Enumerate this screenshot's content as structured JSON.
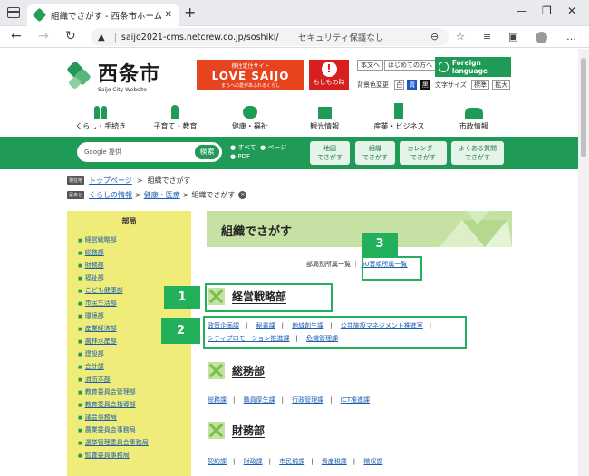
{
  "browser": {
    "tab_title": "組織でさがす - 西条市ホームページ",
    "tab_close": "✕",
    "new_tab": "+",
    "security_label": "セキュリティ保護なし",
    "url": "saijo2021-cms.netcrew.co.jp/soshiki/",
    "window_controls": [
      "—",
      "❐",
      "✕"
    ],
    "toolbar_menu": "…"
  },
  "header": {
    "logo_jp": "西条市",
    "logo_en": "Saijo City Website",
    "banner1_small": "移住定住サイト",
    "banner1_big": "LOVE SAIJO",
    "banner1_tag": "まちへの愛があふれるくらし",
    "banner2_mark": "!",
    "banner2_label": "もしもの時",
    "btn_text_version": "本文へ",
    "btn_first_visit": "はじめての方へ",
    "foreign_language": "Foreign language",
    "bg_color_label": "背景色変更",
    "bg_options": [
      "白",
      "青",
      "黒"
    ],
    "text_size_label": "文字サイズ",
    "text_size_options": [
      "標準",
      "拡大"
    ]
  },
  "global_nav": [
    {
      "label": "くらし・手続き",
      "icon": "family-icon"
    },
    {
      "label": "子育て・教育",
      "icon": "child-icon"
    },
    {
      "label": "健康・福祉",
      "icon": "wheelchair-icon"
    },
    {
      "label": "観光情報",
      "icon": "map-icon"
    },
    {
      "label": "産業・ビジネス",
      "icon": "building-icon"
    },
    {
      "label": "市政情報",
      "icon": "people-icon"
    }
  ],
  "search": {
    "placeholder": "Google 提供",
    "button": "検索",
    "radio_all": "すべて",
    "radio_page": "ページ",
    "radio_pdf": "PDF",
    "boxes": [
      {
        "l1": "地図",
        "l2": "でさがす"
      },
      {
        "l1": "組織",
        "l2": "でさがす"
      },
      {
        "l1": "カレンダー",
        "l2": "でさがす"
      },
      {
        "l1": "よくある質問",
        "l2": "でさがす"
      }
    ]
  },
  "breadcrumb": {
    "current_tag": "現在地",
    "top_page": "トップページ",
    "separator": ">",
    "current": "組織でさがす",
    "footprint_tag": "足あと",
    "fp1": "くらしの情報",
    "fp2": "健康・医療",
    "fp3": "組織でさがす",
    "close": "✕"
  },
  "sidebar": {
    "title": "部局",
    "items": [
      "経営戦略部",
      "総務部",
      "財務部",
      "福祉部",
      "こども健康部",
      "市民生活部",
      "環境部",
      "産業経済部",
      "農林水産部",
      "建設部",
      "会計課",
      "消防本部",
      "教育委員会管理部",
      "教育委員会指導部",
      "議会事務局",
      "農業委員会事務局",
      "選挙管理委員会事務局",
      "監査委員事務局"
    ]
  },
  "main": {
    "title": "組織でさがす",
    "list_dept": "部局別所属一覧",
    "list_sep": "｜",
    "list_50": "50音順所属一覧",
    "sections": [
      {
        "title": "経営戦略部",
        "rows": [
          [
            "政策企画課",
            "秘書課",
            "地域創生課",
            "公共施設マネジメント推進室"
          ],
          [
            "シティプロモーション推進課",
            "危機管理課"
          ]
        ]
      },
      {
        "title": "総務部",
        "rows": [
          [
            "総務課",
            "職員厚生課",
            "行政管理課",
            "ICT推進課"
          ]
        ]
      },
      {
        "title": "財務部",
        "rows": [
          [
            "契約課",
            "財政課",
            "市民税課",
            "資産税課",
            "徴収課"
          ]
        ]
      }
    ]
  },
  "annotations": [
    "1",
    "2",
    "3"
  ],
  "colors": {
    "green": "#1f9a57",
    "light_green": "#c5e2a4",
    "sidebar_yellow": "#f0ec79",
    "link": "#1b5eb0",
    "annotation": "#22b05a"
  }
}
